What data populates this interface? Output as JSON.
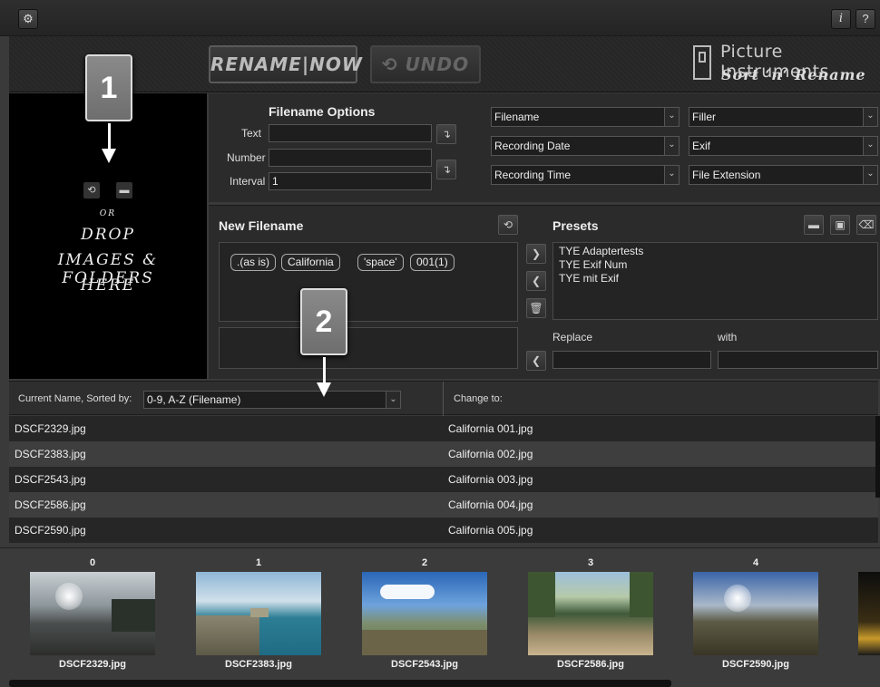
{
  "topbar": {
    "settings_icon": "gear-icon",
    "info_label": "i",
    "help_label": "?"
  },
  "header": {
    "rename_now_label": "RENAME|NOW",
    "undo_label": "UNDO",
    "brand_line1": "Picture Instruments",
    "brand_line2": "Sort ‘n‘ Rename"
  },
  "dropzone": {
    "or": "OR",
    "line1": "DROP",
    "line2": "IMAGES & FOLDERS",
    "line3": "HERE"
  },
  "filename_options": {
    "title": "Filename Options",
    "text_label": "Text",
    "text_value": "",
    "number_label": "Number",
    "number_value": "",
    "interval_label": "Interval",
    "interval_value": "1"
  },
  "selectors": {
    "col1": [
      "Filename",
      "Recording Date",
      "Recording Time"
    ],
    "col2": [
      "Filler",
      "Exif",
      "File Extension"
    ]
  },
  "new_filename": {
    "title": "New Filename",
    "tokens": [
      ".(as is)",
      "California",
      "'space'",
      "001(1)"
    ]
  },
  "presets": {
    "title": "Presets",
    "items": [
      "TYE Adaptertests",
      "TYE Exif Num",
      "TYE mit Exif"
    ],
    "replace_label": "Replace",
    "with_label": "with",
    "replace_value": "",
    "with_value": ""
  },
  "table": {
    "current_label": "Current Name, Sorted by:",
    "sort_value": "0-9, A-Z (Filename)",
    "change_label": "Change to:",
    "rows": [
      {
        "current": "DSCF2329.jpg",
        "new": "California 001.jpg"
      },
      {
        "current": "DSCF2383.jpg",
        "new": "California 002.jpg"
      },
      {
        "current": "DSCF2543.jpg",
        "new": "California 003.jpg"
      },
      {
        "current": "DSCF2586.jpg",
        "new": "California 004.jpg"
      },
      {
        "current": "DSCF2590.jpg",
        "new": "California 005.jpg"
      }
    ]
  },
  "callouts": [
    "1",
    "2"
  ],
  "filmstrip": [
    {
      "index": "0",
      "name": "DSCF2329.jpg"
    },
    {
      "index": "1",
      "name": "DSCF2383.jpg"
    },
    {
      "index": "2",
      "name": "DSCF2543.jpg"
    },
    {
      "index": "3",
      "name": "DSCF2586.jpg"
    },
    {
      "index": "4",
      "name": "DSCF2590.jpg"
    }
  ],
  "colors": {
    "accent_callout": "#7c7c7c",
    "panel": "#2b2b2b",
    "dropzone": "#000000"
  }
}
